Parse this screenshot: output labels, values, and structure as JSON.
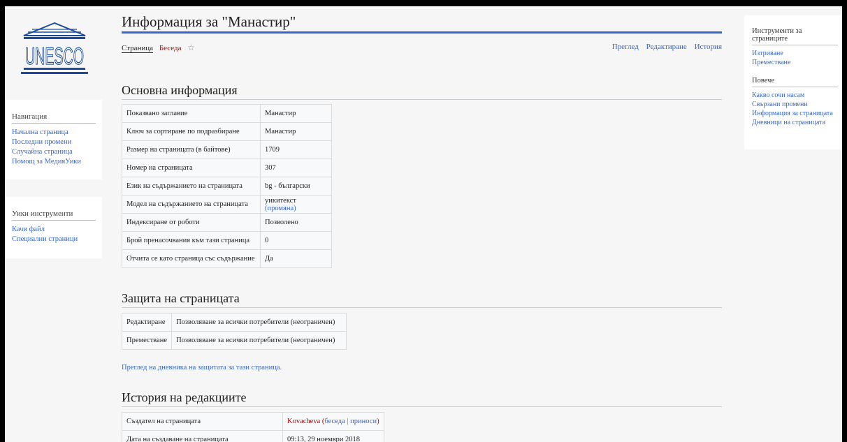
{
  "logo": {
    "text": "UNESCO"
  },
  "sidebar": {
    "navigation": {
      "title": "Навигация",
      "items": [
        "Начална страница",
        "Последни промени",
        "Случайна страница",
        "Помощ за МедияУики"
      ]
    },
    "tools": {
      "title": "Уики инструменти",
      "items": [
        "Качи файл",
        "Специални страници"
      ]
    }
  },
  "right_panel": {
    "page_tools": {
      "title": "Инструменти за страниците",
      "items": [
        "Изтриване",
        "Преместване"
      ]
    },
    "more": {
      "title": "Повече",
      "items": [
        "Какво сочи насам",
        "Свързани промени",
        "Информация за страницата",
        "Дневници на страницата"
      ]
    }
  },
  "page": {
    "title": "Информация за \"Манастир\"",
    "tabs_left": {
      "page": "Страница",
      "talk": "Беседа",
      "star": "☆"
    },
    "tabs_right": {
      "view": "Преглед",
      "edit": "Редактиране",
      "history": "История"
    }
  },
  "basic_info": {
    "heading": "Основна информация",
    "rows": [
      {
        "label": "Показвано заглавие",
        "value": "Манастир"
      },
      {
        "label": "Ключ за сортиране по подразбиране",
        "value": "Манастир"
      },
      {
        "label": "Размер на страницата (в байтове)",
        "value": "1709"
      },
      {
        "label": "Номер на страницата",
        "value": "307"
      },
      {
        "label": "Език на съдържанието на страницата",
        "value": "bg - български"
      },
      {
        "label": "Модел на съдържанието на страницата",
        "value": "уикитекст",
        "value_link": "(промяна)"
      },
      {
        "label": "Индексиране от роботи",
        "value": "Позволено"
      },
      {
        "label": "Брой пренасочвания към тази страница",
        "value": "0"
      },
      {
        "label": "Отчита се като страница със съдържание",
        "value": "Да"
      }
    ]
  },
  "protection": {
    "heading": "Защита на страницата",
    "rows": [
      {
        "label": "Редактиране",
        "value": "Позволяване за всички потребители (неограничен)"
      },
      {
        "label": "Преместване",
        "value": "Позволяване за всички потребители (неограничен)"
      }
    ],
    "log_link": "Преглед на дневника на защитата за тази страница."
  },
  "history": {
    "heading": "История на редакциите",
    "rows": [
      {
        "label": "Създател на страницата",
        "user": "Kovacheva",
        "open": " (",
        "talk": "беседа",
        "sep": " | ",
        "contribs": "приноси",
        "close": ")"
      },
      {
        "label": "Дата на създаване на страницата",
        "value": "09:13, 29 ноември 2018"
      }
    ]
  }
}
